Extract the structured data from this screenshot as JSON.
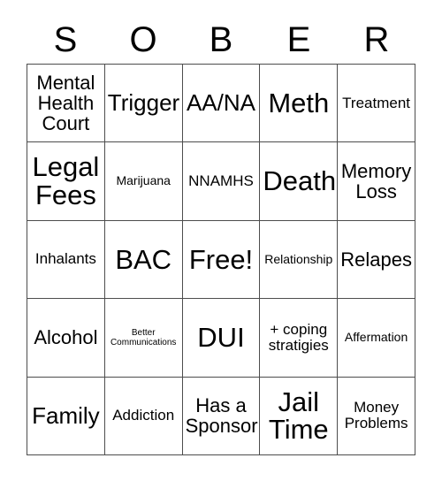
{
  "card": {
    "title_letters": [
      "S",
      "O",
      "B",
      "E",
      "R"
    ],
    "columns": 5,
    "rows": 5,
    "free_space_label": "Free!",
    "free_space_position": {
      "row": 3,
      "column": 3
    },
    "colors": {
      "background": "#ffffff",
      "text": "#000000",
      "grid_line": "#4d4d4d"
    },
    "cells": [
      {
        "text": "Mental\nHealth\nCourt",
        "size": "fs-md",
        "row": 1,
        "column": 1
      },
      {
        "text": "Trigger",
        "size": "fs-lg",
        "row": 1,
        "column": 2
      },
      {
        "text": "AA/NA",
        "size": "fs-lg",
        "row": 1,
        "column": 3
      },
      {
        "text": "Meth",
        "size": "fs-xl",
        "row": 1,
        "column": 4
      },
      {
        "text": "Treatment",
        "size": "fs-sm",
        "row": 1,
        "column": 5
      },
      {
        "text": "Legal\nFees",
        "size": "fs-xl",
        "row": 2,
        "column": 1
      },
      {
        "text": "Marijuana",
        "size": "fs-xs",
        "row": 2,
        "column": 2
      },
      {
        "text": "NNAMHS",
        "size": "fs-sm",
        "row": 2,
        "column": 3
      },
      {
        "text": "Death",
        "size": "fs-xl",
        "row": 2,
        "column": 4
      },
      {
        "text": "Memory\nLoss",
        "size": "fs-md",
        "row": 2,
        "column": 5
      },
      {
        "text": "Inhalants",
        "size": "fs-sm",
        "row": 3,
        "column": 1
      },
      {
        "text": "BAC",
        "size": "fs-xl",
        "row": 3,
        "column": 2
      },
      {
        "text": "Free!",
        "size": "fs-xl",
        "row": 3,
        "column": 3
      },
      {
        "text": "Relationship",
        "size": "fs-xs",
        "row": 3,
        "column": 4
      },
      {
        "text": "Relapes",
        "size": "fs-md",
        "row": 3,
        "column": 5
      },
      {
        "text": "Alcohol",
        "size": "fs-md",
        "row": 4,
        "column": 1
      },
      {
        "text": "Better\nCommunications",
        "size": "fs-xxs",
        "row": 4,
        "column": 2
      },
      {
        "text": "DUI",
        "size": "fs-xl",
        "row": 4,
        "column": 3
      },
      {
        "text": "+ coping\nstratigies",
        "size": "fs-sm",
        "row": 4,
        "column": 4
      },
      {
        "text": "Affermation",
        "size": "fs-xs",
        "row": 4,
        "column": 5
      },
      {
        "text": "Family",
        "size": "fs-lg",
        "row": 5,
        "column": 1
      },
      {
        "text": "Addiction",
        "size": "fs-sm",
        "row": 5,
        "column": 2
      },
      {
        "text": "Has a\nSponsor",
        "size": "fs-md",
        "row": 5,
        "column": 3
      },
      {
        "text": "Jail\nTime",
        "size": "fs-xl",
        "row": 5,
        "column": 4
      },
      {
        "text": "Money\nProblems",
        "size": "fs-sm",
        "row": 5,
        "column": 5
      }
    ]
  }
}
